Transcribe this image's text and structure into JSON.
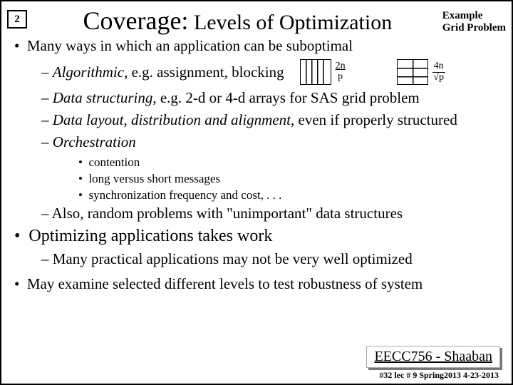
{
  "header": {
    "num": "2",
    "title_cov": "Coverage:",
    "title_rest": " Levels of Optimization",
    "corner_l1": "Example",
    "corner_l2": "Grid Problem"
  },
  "b1": "Many ways in which an application can be suboptimal",
  "s1a_em": "Algorithmic",
  "s1a_rest": ", e.g. assignment, blocking",
  "frac1_top": "2n",
  "frac1_bot": "p",
  "frac2_top": "4n",
  "frac2_bot": "√p",
  "s1b_em": "Data structuring",
  "s1b_rest": ", e.g. 2-d or 4-d arrays for SAS grid problem",
  "s1c_em": "Data layout, distribution and alignment",
  "s1c_rest": ", even if properly structured",
  "s1d_em": "Orchestration",
  "ss1": "contention",
  "ss2": "long versus short messages",
  "ss3": "synchronization frequency and cost, . . .",
  "s1e": "– Also, random problems with \"unimportant\" data structures",
  "b2": "Optimizing applications takes work",
  "s2a": "– Many practical applications may not be very well optimized",
  "b3": "May examine selected different levels to test robustness of system",
  "footer": "EECC756 - Shaaban",
  "footer2": "#32  lec # 9    Spring2013  4-23-2013"
}
